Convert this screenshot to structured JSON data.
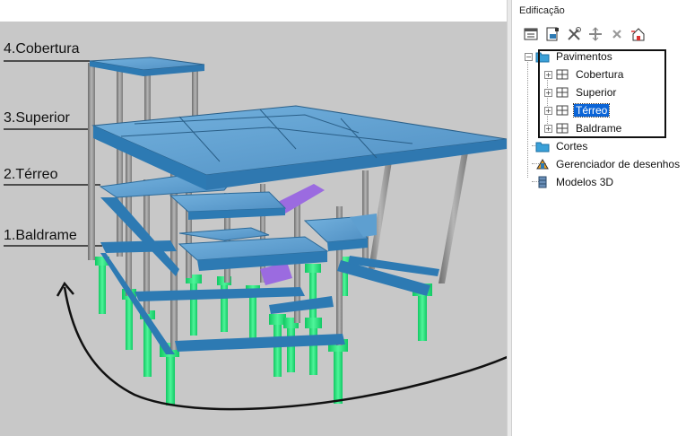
{
  "viewport": {
    "levels": [
      {
        "label": "4.Cobertura"
      },
      {
        "label": "3.Superior"
      },
      {
        "label": "2.Térreo"
      },
      {
        "label": "1.Baldrame"
      }
    ]
  },
  "panel": {
    "title": "Edificação",
    "toolbar": {
      "icons": [
        "structure-tree-icon",
        "edit-document-icon",
        "tools-icon",
        "move-icon",
        "delete-icon",
        "building-icon"
      ]
    },
    "tree": {
      "root": {
        "label": "Pavimentos",
        "expanded": true
      },
      "floors": [
        {
          "label": "Cobertura",
          "selected": false
        },
        {
          "label": "Superior",
          "selected": false
        },
        {
          "label": "Térreo",
          "selected": true
        },
        {
          "label": "Baldrame",
          "selected": false
        }
      ],
      "others": [
        {
          "label": "Cortes",
          "icon": "folder-icon"
        },
        {
          "label": "Gerenciador de desenhos",
          "icon": "drawing-manager-icon"
        },
        {
          "label": "Modelos 3D",
          "icon": "model-3d-icon"
        }
      ]
    }
  },
  "colors": {
    "slab": "#5e9fd0",
    "beam": "#2d7ab3",
    "column": "#8e8e8e",
    "foundation": "#22e37a",
    "stair": "#9b6be0",
    "viewport_bg": "#c8c8c8",
    "selection": "#0a64d7"
  }
}
